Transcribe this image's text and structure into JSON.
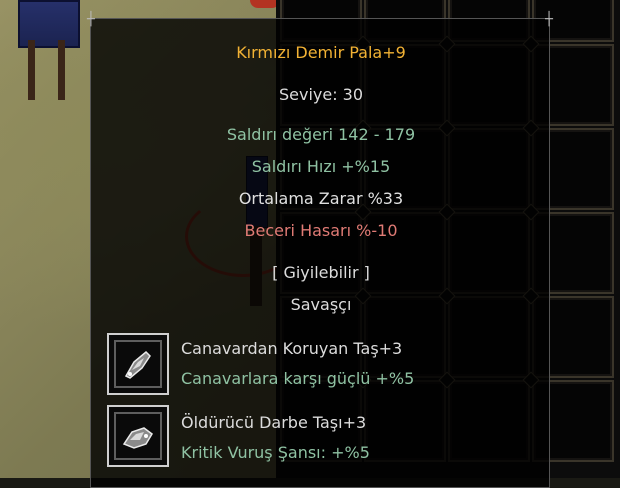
{
  "tooltip": {
    "item_name": "Kırmızı Demir Pala+9",
    "level": "Seviye: 30",
    "attack_value": "Saldırı değeri 142 - 179",
    "attack_speed": "Saldırı Hızı +%15",
    "average_damage": "Ortalama Zarar %33",
    "skill_damage": "Beceri Hasarı %-10",
    "wearable": "[ Giyilebilir ]",
    "class": "Savaşçı",
    "stones": [
      {
        "name": "Canavardan Koruyan Taş+3",
        "bonus": "Canavarlara karşı güçlü +%5",
        "icon": "stone-icon"
      },
      {
        "name": "Öldürücü Darbe Taşı+3",
        "bonus": "Kritik Vuruş Şansı: +%5",
        "icon": "stone-icon"
      }
    ]
  },
  "colors": {
    "item_name": "#f2b234",
    "positive_bonus": "#8fc2a3",
    "negative_bonus": "#e07b75",
    "neutral": "#dcdcdc"
  }
}
